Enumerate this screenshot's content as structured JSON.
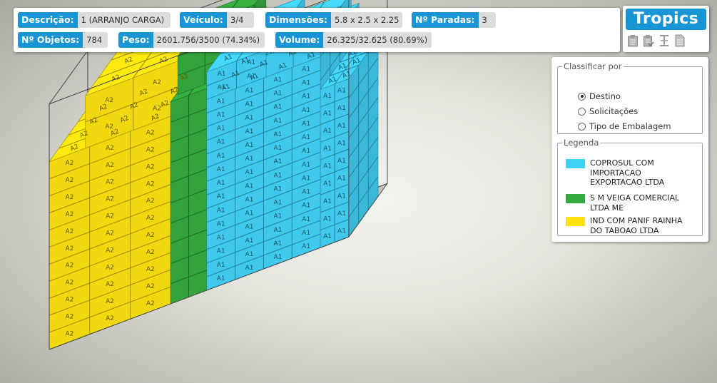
{
  "info": {
    "descricao": {
      "label": "Descrição:",
      "value": "1 (ARRANJO CARGA)"
    },
    "veiculo": {
      "label": "Veículo:",
      "value": "3/4"
    },
    "dimensoes": {
      "label": "Dimensões:",
      "value": "5.8 x 2.5 x 2.25"
    },
    "paradas": {
      "label": "Nº Paradas:",
      "value": "3"
    },
    "objetos": {
      "label": "Nº Objetos:",
      "value": "784"
    },
    "peso": {
      "label": "Peso:",
      "value": "2601.756/3500 (74.34%)"
    },
    "volume": {
      "label": "Volume:",
      "value": "26.325/32.625 (80.69%)"
    }
  },
  "brand": "Tropics",
  "toolbar": [
    "clipboard-icon",
    "clipboard-check-icon",
    "dimension-icon",
    "document-icon"
  ],
  "sort": {
    "title": "Classificar por",
    "options": [
      {
        "label": "Destino",
        "selected": true
      },
      {
        "label": "Solicitações",
        "selected": false
      },
      {
        "label": "Tipo de Embalagem",
        "selected": false
      }
    ]
  },
  "legend": {
    "title": "Legenda",
    "items": [
      {
        "label": "COPROSUL COM IMPORTACAO EXPORTACAO LTDA",
        "color": "#41d1f7"
      },
      {
        "label": "S M VEIGA COMERCIAL LTDA ME",
        "color": "#35aa3e"
      },
      {
        "label": "IND COM PANIF RAINHA DO TABOAO LTDA",
        "color": "#fbe10f"
      }
    ]
  },
  "cargo_labels": {
    "cyan": "A1",
    "yellow": "A2"
  }
}
